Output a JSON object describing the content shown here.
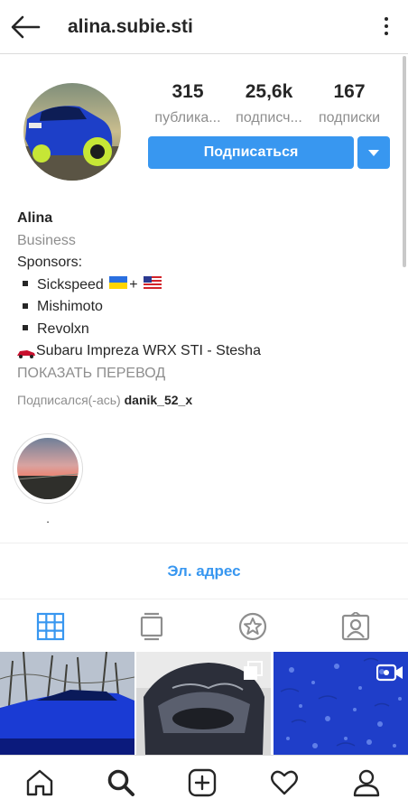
{
  "header": {
    "username": "alina.subie.sti"
  },
  "profile": {
    "stats": [
      {
        "value": "315",
        "label": "публика..."
      },
      {
        "value": "25,6k",
        "label": "подписч..."
      },
      {
        "value": "167",
        "label": "подписки"
      }
    ],
    "follow_label": "Подписаться"
  },
  "bio": {
    "name": "Alina",
    "category": "Business",
    "line_sponsors": "Sponsors:",
    "item1": "Sickspeed",
    "item1_plus": "+",
    "item2": "Mishimoto",
    "item3": "Revolxn",
    "car_line": "Subaru Impreza WRX STI - Stesha",
    "translate": "ПОКАЗАТЬ ПЕРЕВОД",
    "followed_prefix": "Подписался(-ась)",
    "followed_user": "danik_52_x"
  },
  "highlight": {
    "label": "."
  },
  "contact": {
    "email_label": "Эл. адрес"
  },
  "tabs": [
    "grid-icon",
    "igtv-icon",
    "star-icon",
    "tagged-icon"
  ],
  "bottom_nav": [
    "home-icon",
    "search-icon",
    "new-post-icon",
    "heart-icon",
    "profile-icon"
  ],
  "colors": {
    "accent": "#3897f0",
    "muted": "#8e8e8e",
    "text": "#262626"
  }
}
